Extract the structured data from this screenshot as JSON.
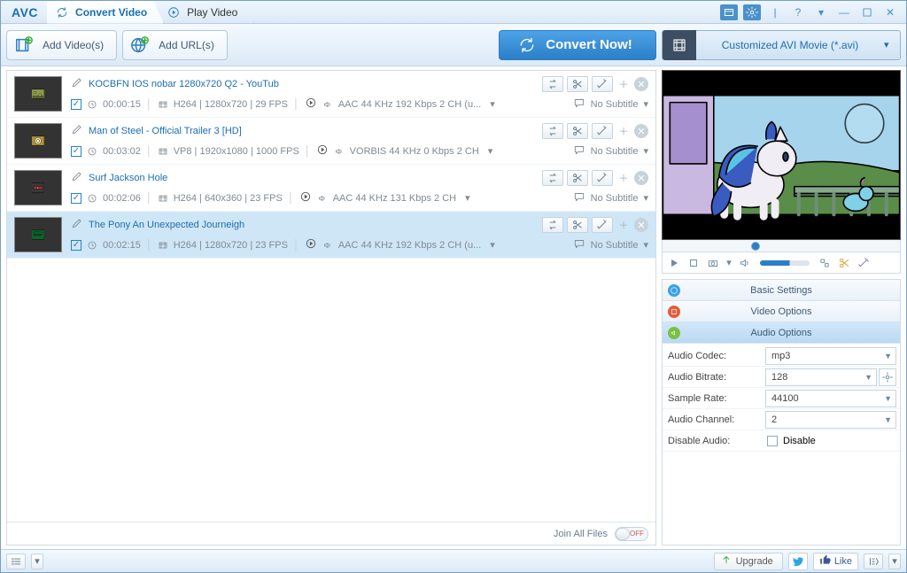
{
  "app": {
    "logo": "AVC"
  },
  "tabs": [
    {
      "label": "Convert Video",
      "icon": "refresh-icon"
    },
    {
      "label": "Play Video",
      "icon": "play-icon"
    }
  ],
  "toolbar": {
    "add_video": "Add Video(s)",
    "add_url": "Add URL(s)",
    "convert": "Convert Now!",
    "profile": "Customized AVI Movie (*.avi)"
  },
  "items": [
    {
      "title": "KOCBFN IOS nobar 1280x720 Q2 - YouTub",
      "duration": "00:00:15",
      "video": "H264 | 1280x720 | 29 FPS",
      "audio": "AAC 44 KHz 192 Kbps 2 CH (u...",
      "subtitle": "No Subtitle",
      "selected": false,
      "thumb": "green"
    },
    {
      "title": "Man of Steel - Official Trailer 3 [HD]",
      "duration": "00:03:02",
      "video": "VP8 | 1920x1080 | 1000 FPS",
      "audio": "VORBIS 44 KHz 0 Kbps 2 CH",
      "subtitle": "No Subtitle",
      "selected": false,
      "thumb": "yellow"
    },
    {
      "title": "Surf Jackson Hole",
      "duration": "00:02:06",
      "video": "H264 | 640x360 | 23 FPS",
      "audio": "AAC 44 KHz 131 Kbps 2 CH",
      "subtitle": "No Subtitle",
      "selected": false,
      "thumb": "grey"
    },
    {
      "title": "The Pony An Unexpected Journeigh",
      "duration": "00:02:15",
      "video": "H264 | 1280x720 | 23 FPS",
      "audio": "AAC 44 KHz 192 Kbps 2 CH (u...",
      "subtitle": "No Subtitle",
      "selected": true,
      "thumb": "dark-green"
    }
  ],
  "list_footer": {
    "join": "Join All Files",
    "toggle": "OFF"
  },
  "accordion": {
    "basic": "Basic Settings",
    "video": "Video Options",
    "audio": "Audio Options",
    "rows": {
      "codec_l": "Audio Codec:",
      "codec_v": "mp3",
      "bitrate_l": "Audio Bitrate:",
      "bitrate_v": "128",
      "sample_l": "Sample Rate:",
      "sample_v": "44100",
      "channel_l": "Audio Channel:",
      "channel_v": "2",
      "disable_l": "Disable Audio:",
      "disable_v": "Disable"
    }
  },
  "status": {
    "upgrade": "Upgrade",
    "like": "Like"
  }
}
